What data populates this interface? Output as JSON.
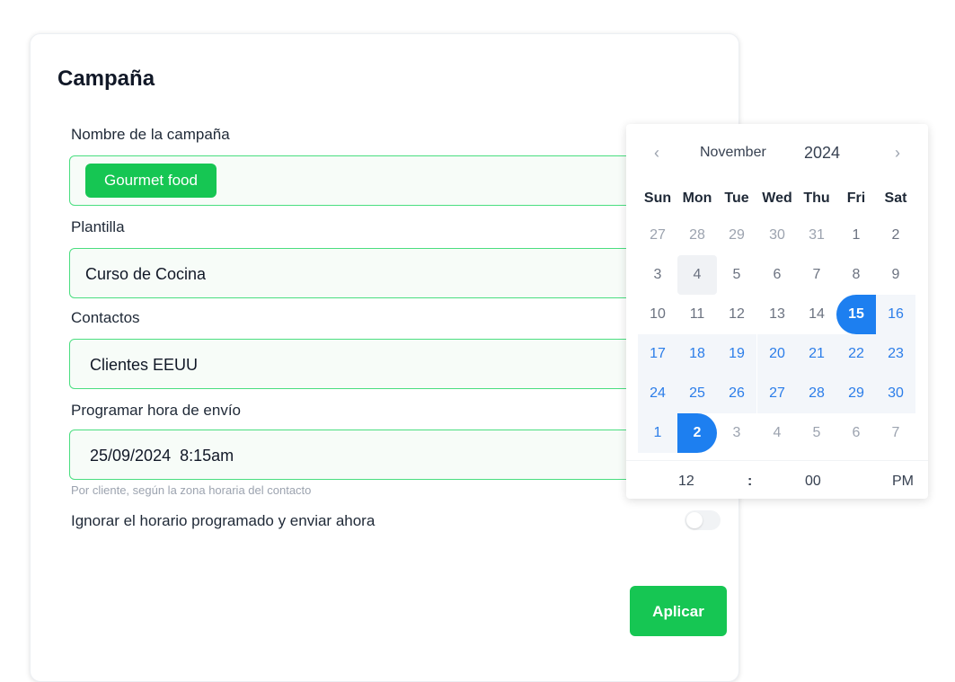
{
  "form": {
    "title": "Campaña",
    "name_label": "Nombre de la campaña",
    "name_tag": "Gourmet food",
    "template_label": "Plantilla",
    "template_value": "Curso de Cocina",
    "contacts_label": "Contactos",
    "contacts_value": "Clientes EEUU",
    "schedule_label": "Programar hora de envío",
    "schedule_value": "25/09/2024  8:15am",
    "schedule_hint": "Por cliente, según la zona horaria del contacto",
    "ignore_label": "Ignorar el horario programado y enviar ahora",
    "ignore_enabled": false,
    "apply_label": "Aplicar"
  },
  "datepicker": {
    "prev_icon": "‹",
    "next_icon": "›",
    "month": "November",
    "year": "2024",
    "weekdays": [
      "Sun",
      "Mon",
      "Tue",
      "Wed",
      "Thu",
      "Fri",
      "Sat"
    ],
    "weeks": [
      [
        "27",
        "28",
        "29",
        "30",
        "31",
        "1",
        "2"
      ],
      [
        "3",
        "4",
        "5",
        "6",
        "7",
        "8",
        "9"
      ],
      [
        "10",
        "11",
        "12",
        "13",
        "14",
        "15",
        "16"
      ],
      [
        "17",
        "18",
        "19",
        "20",
        "21",
        "22",
        "23"
      ],
      [
        "24",
        "25",
        "26",
        "27",
        "28",
        "29",
        "30"
      ],
      [
        "1",
        "2",
        "3",
        "4",
        "5",
        "6",
        "7"
      ]
    ],
    "time": {
      "hour": "12",
      "separator": ":",
      "minute": "00",
      "ampm": "PM"
    }
  },
  "colors": {
    "accent_green": "#16c653",
    "accent_blue": "#1d7ff0"
  }
}
